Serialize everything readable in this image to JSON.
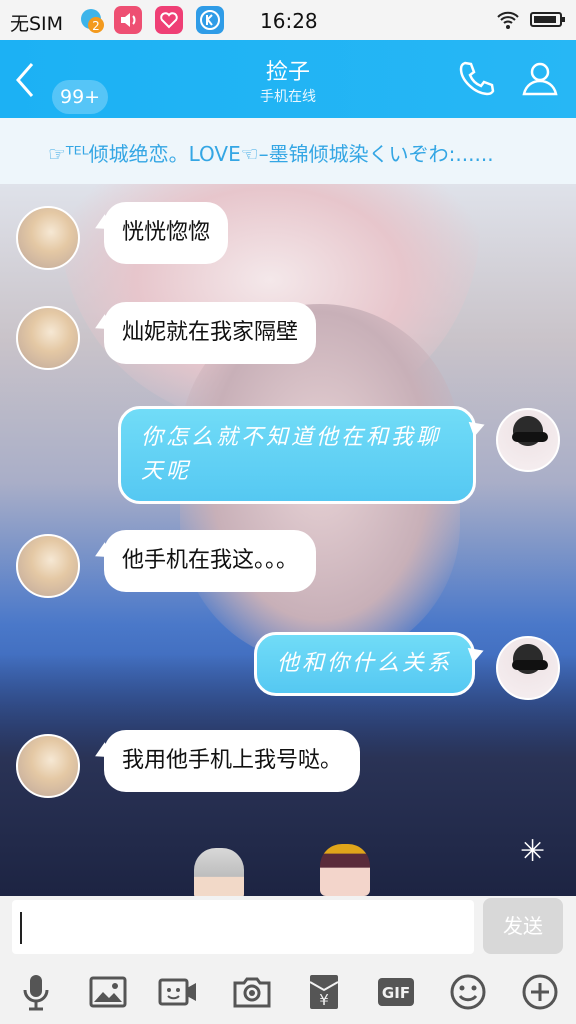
{
  "status_bar": {
    "carrier": "无SIM",
    "qq_badge": "2",
    "time": "16:28"
  },
  "header": {
    "back_badge": "99+",
    "title": "捡子",
    "subtitle": "手机在线"
  },
  "banner": {
    "text": "☞ᵀᴱᴸ倾城绝恋。LOVE☜–墨锦倾城染くいぞわ:......"
  },
  "messages": [
    {
      "side": "left",
      "text": "恍恍惚惚"
    },
    {
      "side": "left",
      "text": "灿妮就在我家隔壁"
    },
    {
      "side": "right",
      "text": "你怎么就不知道他在和我聊天呢"
    },
    {
      "side": "left",
      "text": "他手机在我这。。。"
    },
    {
      "side": "right",
      "text": "他和你什么关系"
    },
    {
      "side": "left",
      "text": "我用他手机上我号哒。"
    }
  ],
  "input": {
    "value": "",
    "send_label": "发送"
  },
  "toolbar": {
    "items": [
      "microphone-icon",
      "image-icon",
      "video-icon",
      "camera-icon",
      "red-packet-icon",
      "gif-icon",
      "emoji-icon",
      "plus-icon"
    ],
    "gif_label": "GIF",
    "red_packet_label": "¥"
  },
  "background_logo": "✳"
}
